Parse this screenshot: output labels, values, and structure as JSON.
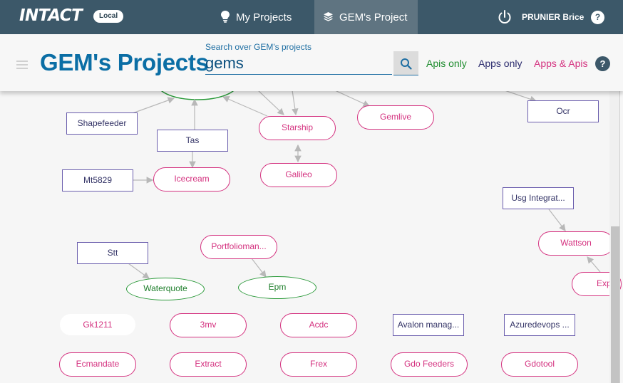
{
  "topbar": {
    "logo": "INTACT",
    "env_badge": "Local",
    "tabs": [
      {
        "label": "My Projects",
        "icon": "lightbulb-icon"
      },
      {
        "label": "GEM's Project",
        "icon": "layers-icon",
        "active": true
      }
    ],
    "user_name": "PRUNIER Brice",
    "help": "?"
  },
  "header": {
    "title": "GEM's Projects",
    "search": {
      "label": "Search over GEM's projects",
      "value": "gems"
    },
    "filters": [
      {
        "label": "Apis only",
        "color": "#1e8c2e"
      },
      {
        "label": "Apps only",
        "color": "#2c2c6e"
      },
      {
        "label": "Apps & Apis",
        "color": "#d4317f"
      }
    ],
    "help": "?"
  },
  "graph": {
    "legend_colors": {
      "app": "#d4317f",
      "api": "#2b9a3a",
      "project": "#6a5dad"
    },
    "nodes": {
      "shapefeeder": "Shapefeeder",
      "tas": "Tas",
      "mt5829": "Mt5829",
      "icecream": "Icecream",
      "starship": "Starship",
      "galileo": "Galileo",
      "gemlive": "Gemlive",
      "ocr": "Ocr",
      "usg": "Usg Integrat...",
      "wattson": "Wattson",
      "exp": "Exp",
      "stt": "Stt",
      "waterquote": "Waterquote",
      "portfolioman": "Portfolioman...",
      "epm": "Epm",
      "gk1211": "Gk1211",
      "3mv": "3mv",
      "acdc": "Acdc",
      "avalon": "Avalon manag...",
      "azuredevops": "Azuredevops ...",
      "ecmandate": "Ecmandate",
      "extract": "Extract",
      "frex": "Frex",
      "gdo_feeders": "Gdo Feeders",
      "gdotool": "Gdotool"
    }
  }
}
